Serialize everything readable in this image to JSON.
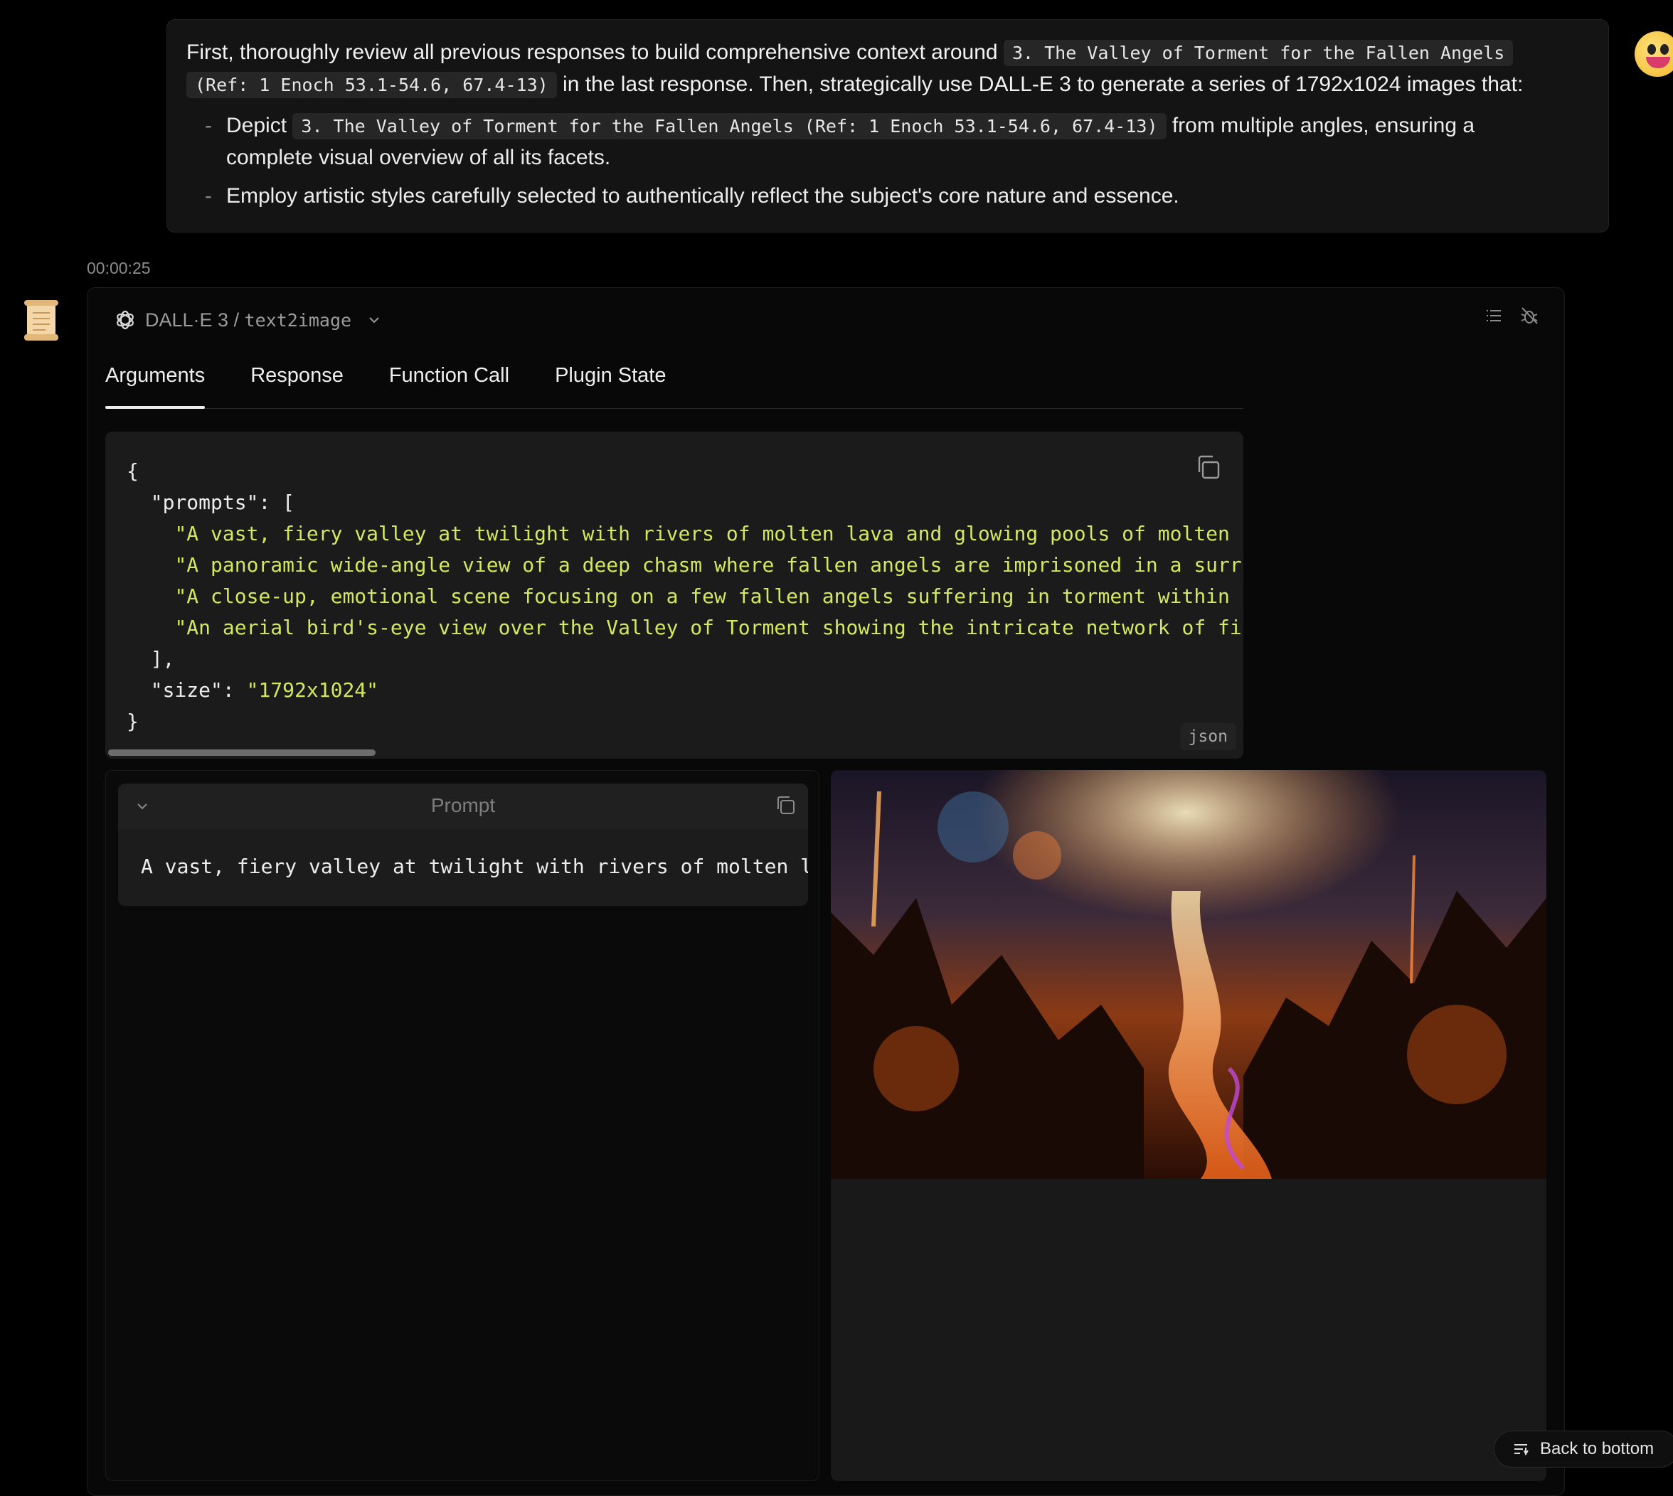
{
  "user_message": {
    "intro": "First, thoroughly review all previous responses to build comprehensive context around",
    "subject_code_line1": "3. The Valley of Torment for the Fallen Angels",
    "subject_code_line2": "(Ref: 1 Enoch 53.1-54.6, 67.4-13)",
    "after_code": " in the last response. Then, strategically use DALL-E 3 to generate a series of 1792x1024 images that:",
    "bullet1_prefix": "Depict",
    "bullet1_code": "3. The Valley of Torment for the Fallen Angels (Ref: 1 Enoch 53.1-54.6, 67.4-13)",
    "bullet1_suffix": " from multiple angles, ensuring a complete visual overview of all its facets.",
    "bullet2": "Employ artistic styles carefully selected to authentically reflect the subject's core nature and essence.",
    "bullet_dash": "-"
  },
  "timestamp": "00:00:25",
  "tool": {
    "name": "DALL·E 3",
    "separator": " / ",
    "api": "text2image",
    "tabs": [
      "Arguments",
      "Response",
      "Function Call",
      "Plugin State"
    ],
    "active_tab": "Arguments"
  },
  "code": {
    "open_brace": "{",
    "prompts_key": "\"prompts\"",
    "colon_bracket": ": [",
    "prompts": [
      "\"A vast, fiery valley at twilight with rivers of molten lava and glowing pools of molten",
      "\"A panoramic wide-angle view of a deep chasm where fallen angels are imprisoned in a surr",
      "\"A close-up, emotional scene focusing on a few fallen angels suffering in torment within",
      "\"An aerial bird's-eye view over the Valley of Torment showing the intricate network of fi"
    ],
    "close_bracket": "],",
    "size_key": "\"size\"",
    "colon": ": ",
    "size_value": "\"1792x1024\"",
    "close_brace": "}",
    "language": "json"
  },
  "prompt_card": {
    "title": "Prompt",
    "text": "A vast, fiery valley at twilight with rivers of molten l"
  },
  "back_to_bottom": "Back to bottom",
  "colors": {
    "background": "#000000",
    "panel": "#080808",
    "code_bg": "#1b1b1b",
    "string": "#d3e85c",
    "muted": "#8c8c8c"
  }
}
